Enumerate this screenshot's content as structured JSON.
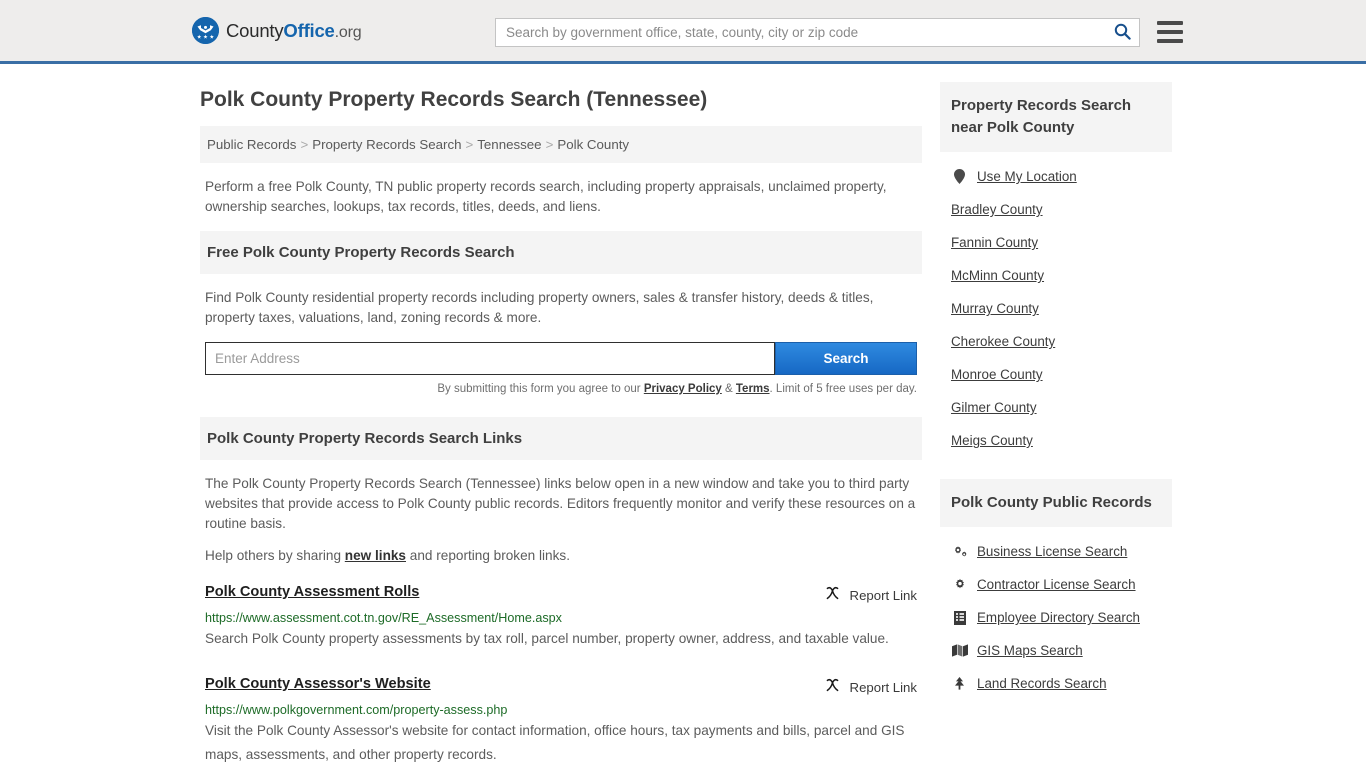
{
  "header": {
    "logo_name_1": "County",
    "logo_name_2": "Office",
    "logo_name_3": ".org",
    "search_placeholder": "Search by government office, state, county, city or zip code",
    "search_value": "",
    "search_icon": "search-icon",
    "menu_icon": "hamburger-menu-icon",
    "accent_color": "#3a6ea5"
  },
  "page": {
    "title": "Polk County Property Records Search (Tennessee)",
    "intro": "Perform a free Polk County, TN public property records search, including property appraisals, unclaimed property, ownership searches, lookups, tax records, titles, deeds, and liens."
  },
  "breadcrumb": {
    "items": [
      "Public Records",
      "Property Records Search",
      "Tennessee",
      "Polk County"
    ],
    "separator": ">"
  },
  "free_search": {
    "heading": "Free Polk County Property Records Search",
    "description": "Find Polk County residential property records including property owners, sales & transfer history, deeds & titles, property taxes, valuations, land, zoning records & more.",
    "input_placeholder": "Enter Address",
    "input_value": "",
    "button_label": "Search",
    "disclaimer_prefix": "By submitting this form you agree to our ",
    "privacy_label": "Privacy Policy",
    "disclaimer_amp": " & ",
    "terms_label": "Terms",
    "disclaimer_suffix": ". Limit of 5 free uses per day.",
    "button_color": "#1668c4"
  },
  "links_section": {
    "heading": "Polk County Property Records Search Links",
    "paragraph": "The Polk County Property Records Search (Tennessee) links below open in a new window and take you to third party websites that provide access to Polk County public records. Editors frequently monitor and verify these resources on a routine basis.",
    "help_prefix": "Help others by sharing ",
    "help_link": "new links",
    "help_suffix": " and reporting broken links.",
    "report_label": "Report Link",
    "report_icon": "broken-link-icon",
    "results": [
      {
        "title": "Polk County Assessment Rolls",
        "url": "https://www.assessment.cot.tn.gov/RE_Assessment/Home.aspx",
        "description": "Search Polk County property assessments by tax roll, parcel number, property owner, address, and taxable value."
      },
      {
        "title": "Polk County Assessor's Website",
        "url": "https://www.polkgovernment.com/property-assess.php",
        "description": "Visit the Polk County Assessor's website for contact information, office hours, tax payments and bills, parcel and GIS maps, assessments, and other property records."
      }
    ]
  },
  "sidebar": {
    "nearby": {
      "heading": "Property Records Search near Polk County",
      "items": [
        {
          "label": "Use My Location",
          "icon": "map-pin-icon"
        },
        {
          "label": "Bradley County",
          "icon": ""
        },
        {
          "label": "Fannin County",
          "icon": ""
        },
        {
          "label": "McMinn County",
          "icon": ""
        },
        {
          "label": "Murray County",
          "icon": ""
        },
        {
          "label": "Cherokee County",
          "icon": ""
        },
        {
          "label": "Monroe County",
          "icon": ""
        },
        {
          "label": "Gilmer County",
          "icon": ""
        },
        {
          "label": "Meigs County",
          "icon": ""
        }
      ]
    },
    "public_records": {
      "heading": "Polk County Public Records",
      "items": [
        {
          "label": "Business License Search",
          "icon": "gears-icon"
        },
        {
          "label": "Contractor License Search",
          "icon": "gear-icon"
        },
        {
          "label": "Employee Directory Search",
          "icon": "book-icon"
        },
        {
          "label": "GIS Maps Search",
          "icon": "map-icon"
        },
        {
          "label": "Land Records Search",
          "icon": "tree-icon"
        }
      ]
    }
  }
}
